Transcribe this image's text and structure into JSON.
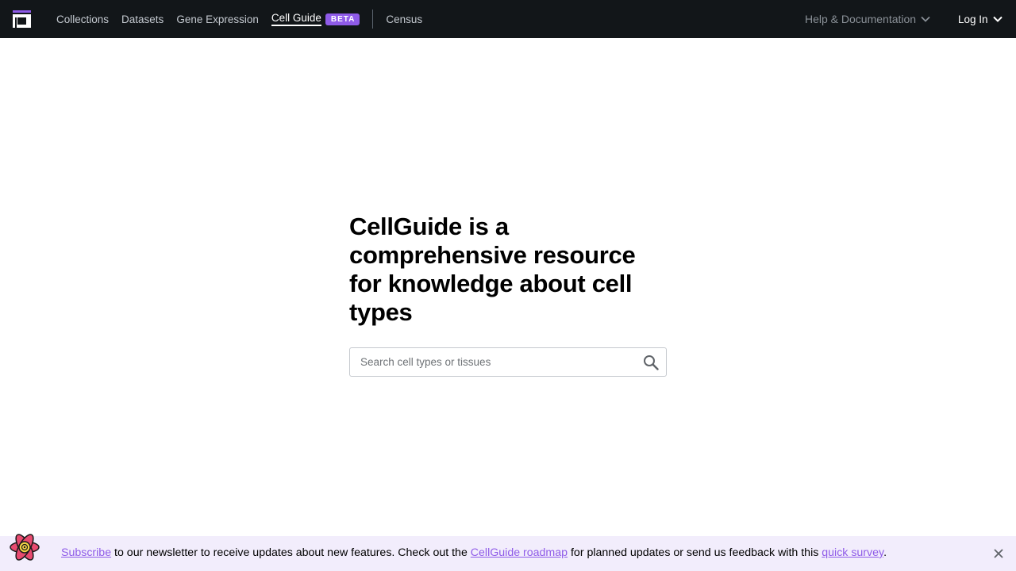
{
  "nav": {
    "items": [
      {
        "label": "Collections"
      },
      {
        "label": "Datasets"
      },
      {
        "label": "Gene Expression"
      },
      {
        "label": "Cell Guide",
        "active": true
      },
      {
        "label": "Census"
      }
    ],
    "badge": "BETA",
    "help_label": "Help & Documentation",
    "login_label": "Log In"
  },
  "hero": {
    "title": "CellGuide is a comprehensive resource for knowledge about cell types"
  },
  "search": {
    "placeholder": "Search cell types or tissues",
    "value": ""
  },
  "banner": {
    "subscribe_link": "Subscribe",
    "text_1": " to our newsletter to receive updates about new features. Check out the ",
    "roadmap_link": "CellGuide roadmap",
    "text_2": " for planned updates or send us feedback with this ",
    "survey_link": "quick survey",
    "text_3": "."
  },
  "icons": {
    "logo": "czi-logo-icon",
    "chevron": "chevron-down-icon",
    "search": "search-icon",
    "banner_logo": "atom-icon",
    "close": "close-icon"
  },
  "colors": {
    "nav_bg": "#121619",
    "accent": "#8f5be8",
    "banner_bg": "#f2edfc"
  }
}
